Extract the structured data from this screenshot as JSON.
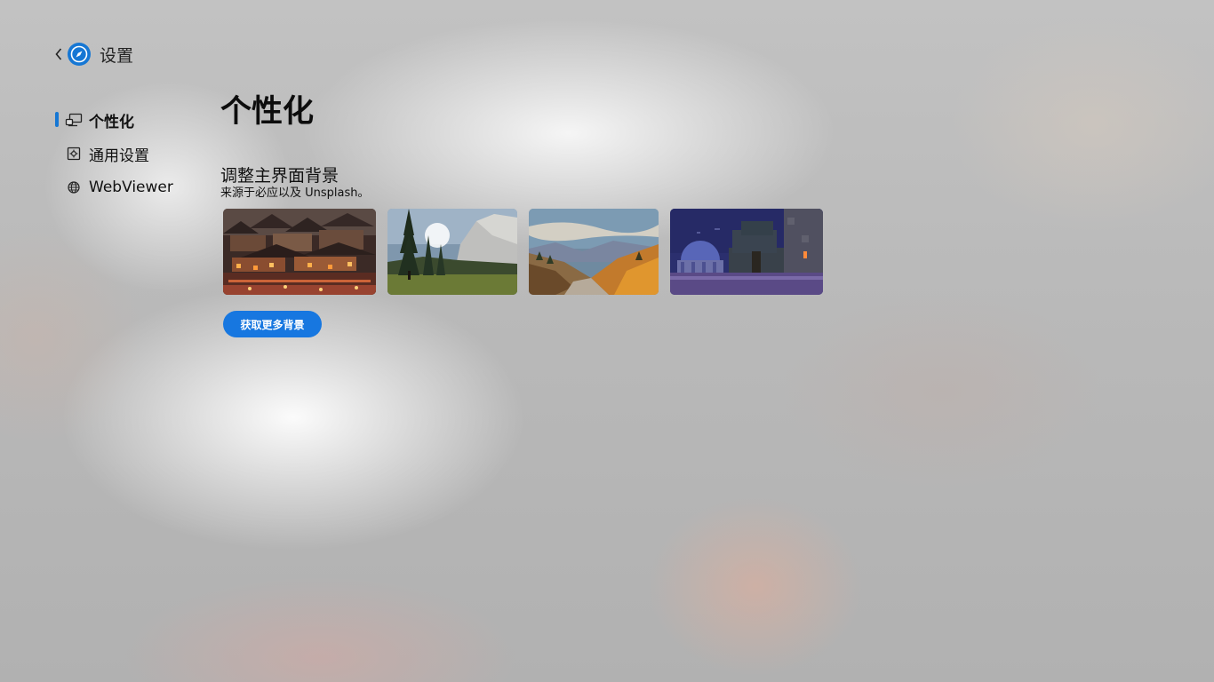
{
  "header": {
    "title": "设置",
    "back_icon": "chevron-left-icon",
    "logo_icon": "compass-icon"
  },
  "sidebar": {
    "items": [
      {
        "label": "个性化",
        "icon": "personalization-icon",
        "active": true
      },
      {
        "label": "通用设置",
        "icon": "settings-icon",
        "active": false
      },
      {
        "label": "WebViewer",
        "icon": "globe-icon",
        "active": false
      }
    ]
  },
  "main": {
    "title": "个性化",
    "background_section": {
      "title": "调整主界面背景",
      "subtitle": "来源于必应以及 Unsplash。",
      "wallpapers": [
        "ancient-town-night",
        "granite-cliff-forest",
        "autumn-mountain-valley",
        "blocky-night-scene"
      ],
      "more_button": "获取更多背景"
    }
  },
  "colors": {
    "accent": "#1677d4",
    "button": "#1777e0"
  }
}
